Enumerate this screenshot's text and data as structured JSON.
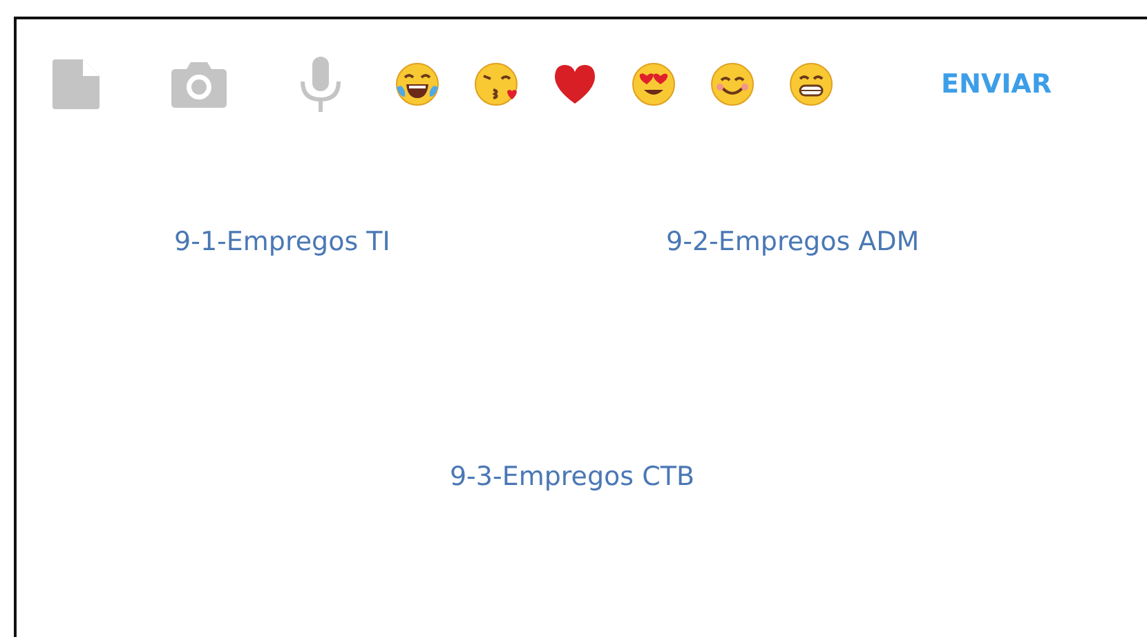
{
  "toolbar": {
    "send_button": "ENVIAR"
  },
  "links": [
    {
      "label": "9-1-Empregos TI"
    },
    {
      "label": "9-2-Empregos ADM"
    },
    {
      "label": "9-3-Empregos CTB"
    }
  ]
}
